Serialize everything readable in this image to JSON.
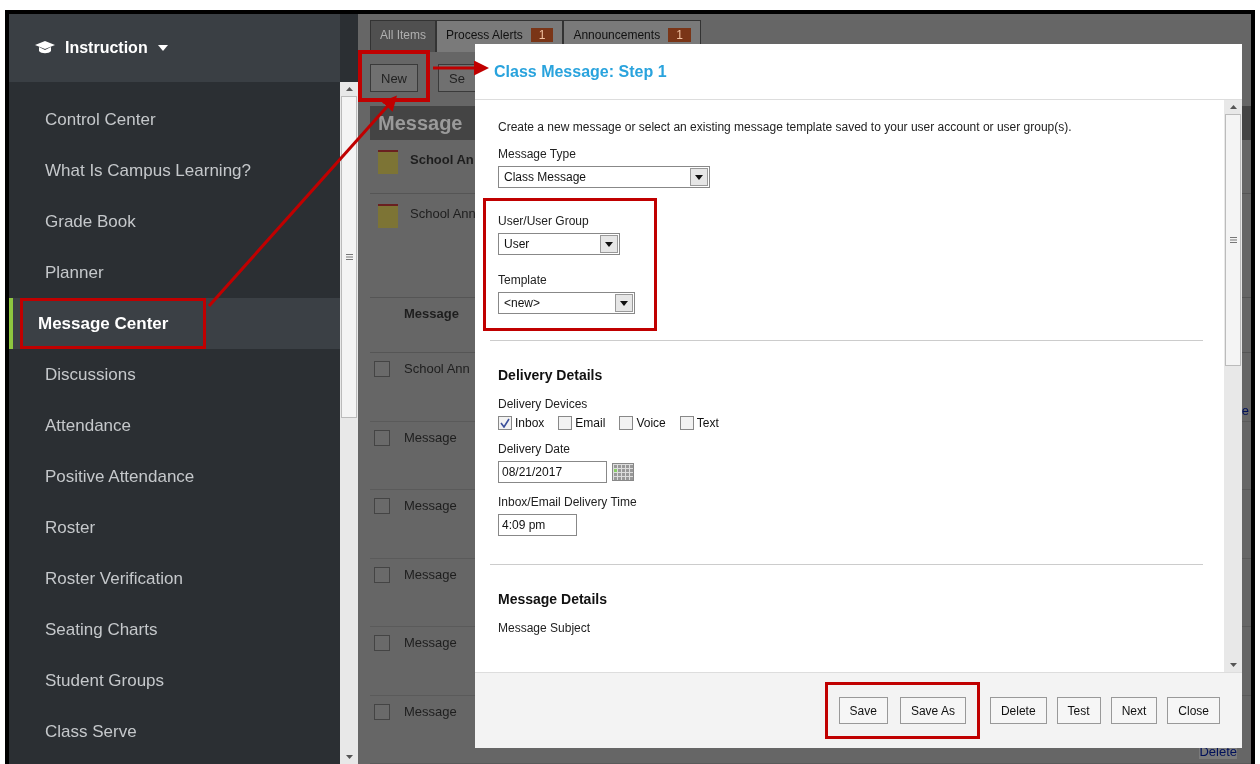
{
  "sidebar": {
    "title": "Instruction",
    "items": [
      {
        "label": "Control Center",
        "selected": false,
        "highlighted": false
      },
      {
        "label": "What Is Campus Learning?",
        "selected": false,
        "highlighted": false
      },
      {
        "label": "Grade Book",
        "selected": false,
        "highlighted": false
      },
      {
        "label": "Planner",
        "selected": false,
        "highlighted": false
      },
      {
        "label": "Message Center",
        "selected": true,
        "highlighted": true
      },
      {
        "label": "Discussions",
        "selected": false,
        "highlighted": false
      },
      {
        "label": "Attendance",
        "selected": false,
        "highlighted": false
      },
      {
        "label": "Positive Attendance",
        "selected": false,
        "highlighted": false
      },
      {
        "label": "Roster",
        "selected": false,
        "highlighted": false
      },
      {
        "label": "Roster Verification",
        "selected": false,
        "highlighted": false
      },
      {
        "label": "Seating Charts",
        "selected": false,
        "highlighted": false
      },
      {
        "label": "Student Groups",
        "selected": false,
        "highlighted": false
      },
      {
        "label": "Class Serve",
        "selected": false,
        "highlighted": false
      }
    ]
  },
  "message_center": {
    "tabs": [
      {
        "label": "All Items",
        "selected": true
      },
      {
        "label": "Process Alerts",
        "badge": "1",
        "selected": false
      },
      {
        "label": "Announcements",
        "badge": "1",
        "selected": false
      }
    ],
    "new_button": "New",
    "select_button": "Se",
    "heading": "Message",
    "announcements": [
      {
        "title": "School An",
        "unread": true
      },
      {
        "title": "School Ann",
        "unread": false
      }
    ],
    "column_header": "Message",
    "rows": [
      {
        "label": "School Ann",
        "checked": false,
        "link": "e"
      },
      {
        "label": "Message",
        "checked": false
      },
      {
        "label": "Message",
        "checked": false
      },
      {
        "label": "Message",
        "checked": false
      },
      {
        "label": "Message",
        "checked": false
      },
      {
        "label": "Message",
        "checked": false,
        "link": "Delete"
      }
    ]
  },
  "dialog": {
    "title": "Class Message: Step 1",
    "intro": "Create a new message or select an existing message template saved to your user account or user group(s).",
    "message_type": {
      "label": "Message Type",
      "value": "Class Message"
    },
    "user_group": {
      "label": "User/User Group",
      "value": "User"
    },
    "template": {
      "label": "Template",
      "value": "<new>"
    },
    "delivery_heading": "Delivery Details",
    "devices_label": "Delivery Devices",
    "devices": [
      {
        "label": "Inbox",
        "checked": true
      },
      {
        "label": "Email",
        "checked": false
      },
      {
        "label": "Voice",
        "checked": false
      },
      {
        "label": "Text",
        "checked": false
      }
    ],
    "date": {
      "label": "Delivery Date",
      "value": "08/21/2017"
    },
    "time": {
      "label": "Inbox/Email Delivery Time",
      "value": "4:09 pm"
    },
    "message_heading": "Message Details",
    "subject_label": "Message Subject",
    "buttons": [
      {
        "label": "Save",
        "highlighted": true
      },
      {
        "label": "Save As",
        "highlighted": true
      },
      {
        "label": "Delete",
        "highlighted": false
      },
      {
        "label": "Test",
        "highlighted": false
      },
      {
        "label": "Next",
        "highlighted": false
      },
      {
        "label": "Close",
        "highlighted": false
      }
    ]
  }
}
